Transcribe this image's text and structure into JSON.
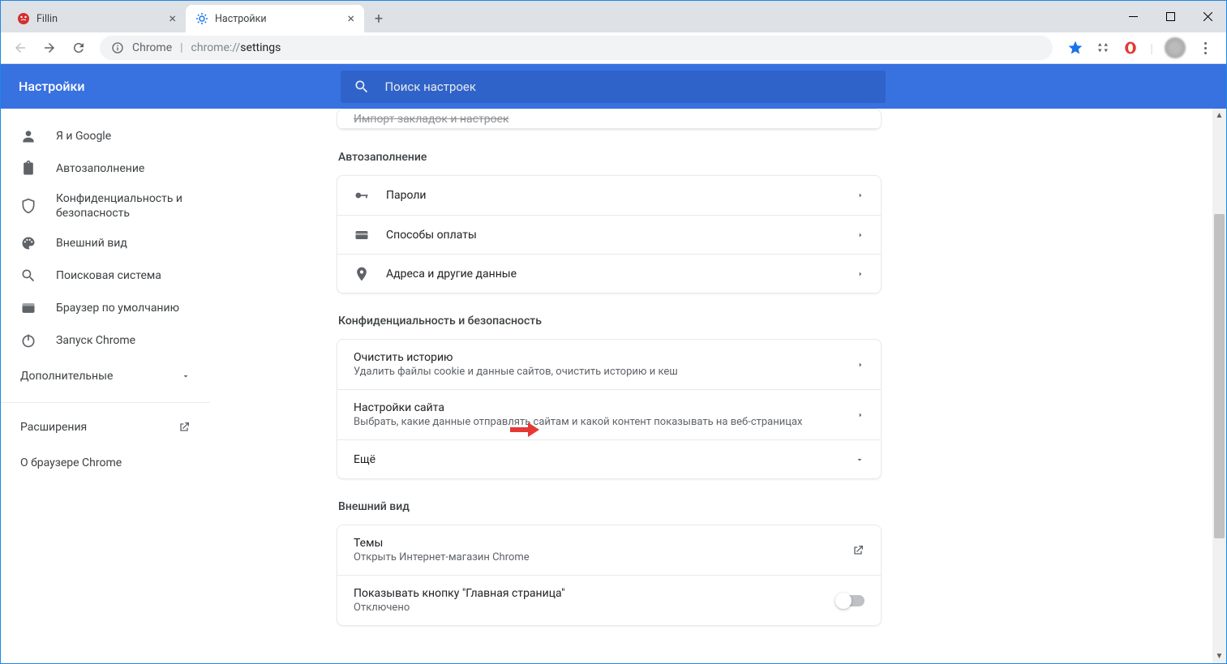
{
  "tabs": [
    {
      "title": "Fillin"
    },
    {
      "title": "Настройки"
    }
  ],
  "addressbar": {
    "scheme": "Chrome",
    "url_prefix": "chrome://",
    "url_suffix": "settings"
  },
  "header": {
    "title": "Настройки",
    "search_placeholder": "Поиск настроек"
  },
  "sidebar": {
    "items": [
      {
        "label": "Я и Google"
      },
      {
        "label": "Автозаполнение"
      },
      {
        "label": "Конфиденциальность и безопасность"
      },
      {
        "label": "Внешний вид"
      },
      {
        "label": "Поисковая система"
      },
      {
        "label": "Браузер по умолчанию"
      },
      {
        "label": "Запуск Chrome"
      }
    ],
    "advanced": "Дополнительные",
    "extensions": "Расширения",
    "about": "О браузере Chrome"
  },
  "content": {
    "truncated_row": "Импорт закладок и настроек",
    "autofill": {
      "title": "Автозаполнение",
      "passwords": "Пароли",
      "payment": "Способы оплаты",
      "addresses": "Адреса и другие данные"
    },
    "privacy": {
      "title": "Конфиденциальность и безопасность",
      "clear_title": "Очистить историю",
      "clear_sub": "Удалить файлы cookie и данные сайтов, очистить историю и кеш",
      "site_title": "Настройки сайта",
      "site_sub": "Выбрать, какие данные отправлять сайтам и какой контент показывать на веб-страницах",
      "more": "Ещё"
    },
    "appearance": {
      "title": "Внешний вид",
      "themes_title": "Темы",
      "themes_sub": "Открыть Интернет-магазин Chrome",
      "home_title": "Показывать кнопку \"Главная страница\"",
      "home_sub": "Отключено"
    }
  }
}
